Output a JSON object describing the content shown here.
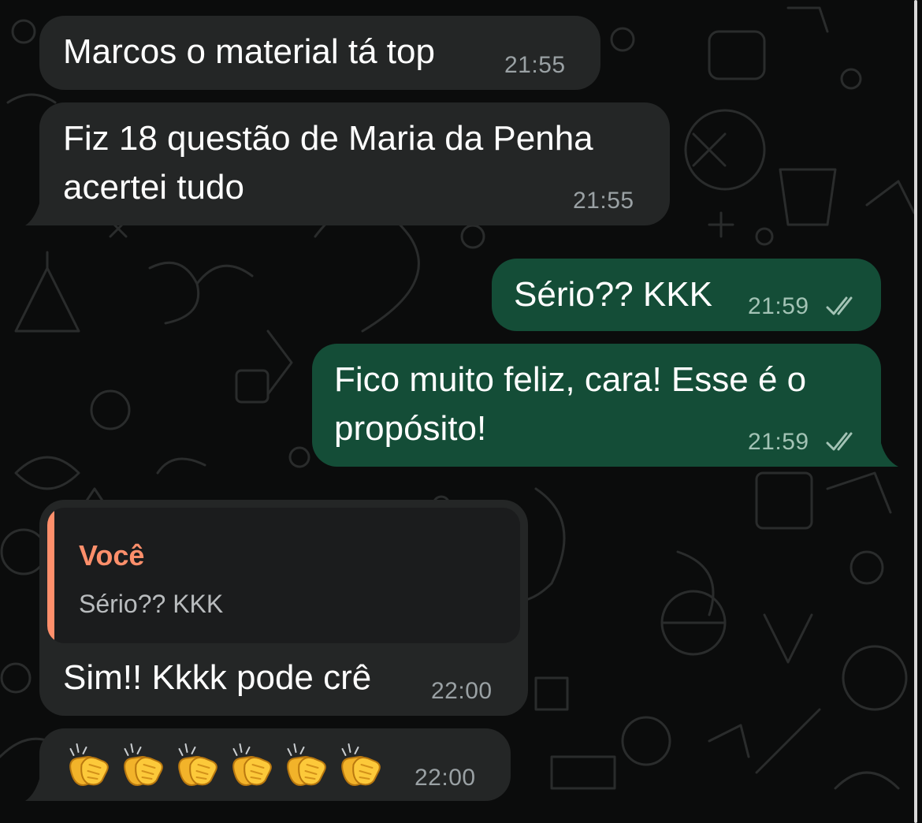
{
  "chat": {
    "messages": [
      {
        "direction": "incoming",
        "text": "Marcos o material tá top",
        "time": "21:55"
      },
      {
        "direction": "incoming",
        "lines": [
          "Fiz 18 questão de Maria da Penha",
          "acertei tudo"
        ],
        "time": "21:55"
      },
      {
        "direction": "outgoing",
        "text": "Sério?? KKK",
        "time": "21:59",
        "status": "read"
      },
      {
        "direction": "outgoing",
        "lines": [
          "Fico muito feliz, cara! Esse é o",
          "propósito!"
        ],
        "time": "21:59",
        "status": "read"
      },
      {
        "direction": "incoming",
        "reply_to": {
          "author": "Você",
          "text": "Sério?? KKK"
        },
        "text": "Sim!! Kkkk pode crê",
        "time": "22:00"
      },
      {
        "direction": "incoming",
        "emoji": [
          "clapping-hands",
          "clapping-hands",
          "clapping-hands",
          "clapping-hands",
          "clapping-hands",
          "clapping-hands"
        ],
        "time": "22:00"
      }
    ]
  },
  "colors": {
    "background": "#0b0c0c",
    "incoming_bubble": "#242626",
    "outgoing_bubble": "#144d37",
    "quote_accent": "#ff8f6b",
    "text": "#ffffff",
    "timestamp": "#9aa1a4"
  }
}
